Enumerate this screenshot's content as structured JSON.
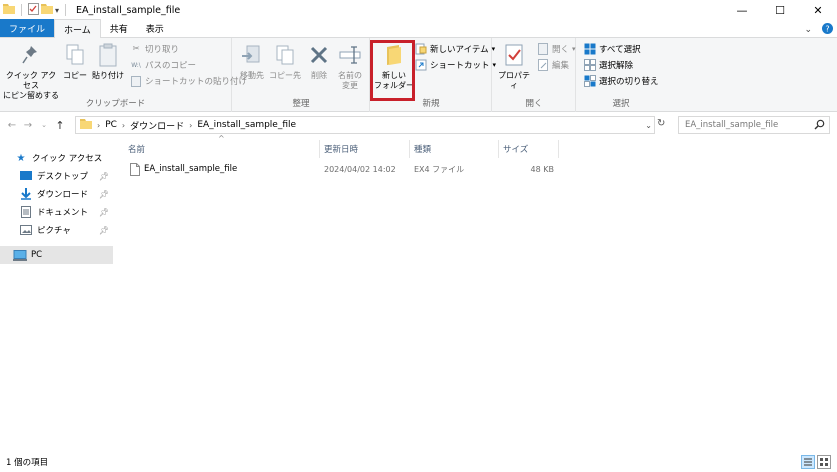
{
  "window": {
    "title": "EA_install_sample_file",
    "controls": {
      "minimize": "—",
      "maximize": "☐",
      "close": "✕"
    }
  },
  "tabs": [
    {
      "label": "ファイル"
    },
    {
      "label": "ホーム"
    },
    {
      "label": "共有"
    },
    {
      "label": "表示"
    }
  ],
  "ribbon": {
    "clipboard": {
      "pin_label_1": "クイック アクセス",
      "pin_label_2": "にピン留めする",
      "copy": "コピー",
      "paste": "貼り付け",
      "cut": "切り取り",
      "copy_path": "パスのコピー",
      "paste_shortcut": "ショートカットの貼り付け",
      "group": "クリップボード"
    },
    "organize": {
      "move_to": "移動先",
      "copy_to": "コピー先",
      "delete": "削除",
      "rename_1": "名前の",
      "rename_2": "変更",
      "group": "整理"
    },
    "new": {
      "new_folder_1": "新しい",
      "new_folder_2": "フォルダー",
      "new_item": "新しいアイテム",
      "shortcut": "ショートカット",
      "group": "新規"
    },
    "open": {
      "properties": "プロパティ",
      "open": "開く",
      "edit": "編集",
      "group": "開く"
    },
    "select": {
      "select_all": "すべて選択",
      "select_none": "選択解除",
      "invert": "選択の切り替え",
      "group": "選択"
    }
  },
  "address": {
    "crumbs": [
      "PC",
      "ダウンロード",
      "EA_install_sample_file"
    ],
    "search_placeholder": "EA_install_sample_file"
  },
  "nav": {
    "quick_access": "クイック アクセス",
    "items": [
      {
        "label": "デスクトップ"
      },
      {
        "label": "ダウンロード"
      },
      {
        "label": "ドキュメント"
      },
      {
        "label": "ピクチャ"
      }
    ],
    "pc": "PC"
  },
  "columns": {
    "name": "名前",
    "date": "更新日時",
    "type": "種類",
    "size": "サイズ"
  },
  "files": [
    {
      "name": "EA_install_sample_file",
      "date": "2024/04/02 14:02",
      "type": "EX4 ファイル",
      "size": "48 KB"
    }
  ],
  "status": {
    "count": "1 個の項目"
  },
  "colors": {
    "file_tab": "#1979ca",
    "highlight": "#c8202a",
    "ribbon_bg": "#f5f6f7"
  }
}
